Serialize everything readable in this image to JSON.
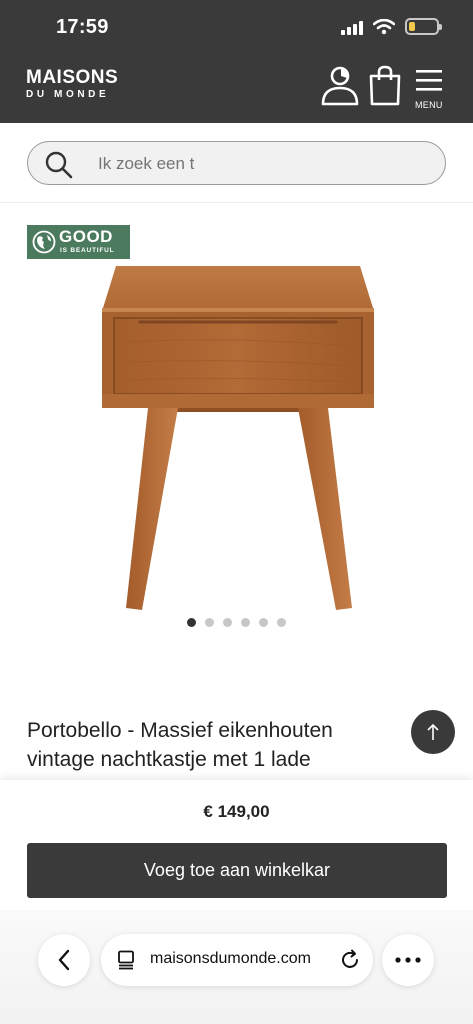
{
  "status_bar": {
    "time": "17:59"
  },
  "brand": {
    "line1": "MAISONS",
    "line2": "DU MONDE"
  },
  "header": {
    "menu_label": "MENU"
  },
  "search": {
    "placeholder": "Ik zoek een t"
  },
  "badge": {
    "title": "GOOD",
    "subtitle": "IS BEAUTIFUL",
    "color": "#4c7a5e"
  },
  "gallery": {
    "image_count": 6,
    "active_index": 0
  },
  "product": {
    "title": "Portobello - Massief eikenhouten vintage nachtkastje met 1 lade",
    "price": "€ 149,00",
    "add_to_cart_label": "Voeg toe aan winkelkar"
  },
  "browser": {
    "url": "maisonsdumonde.com"
  },
  "colors": {
    "header_bg": "#3a3a3a",
    "button_bg": "#3a3a3a",
    "wood": "#b06a35"
  }
}
